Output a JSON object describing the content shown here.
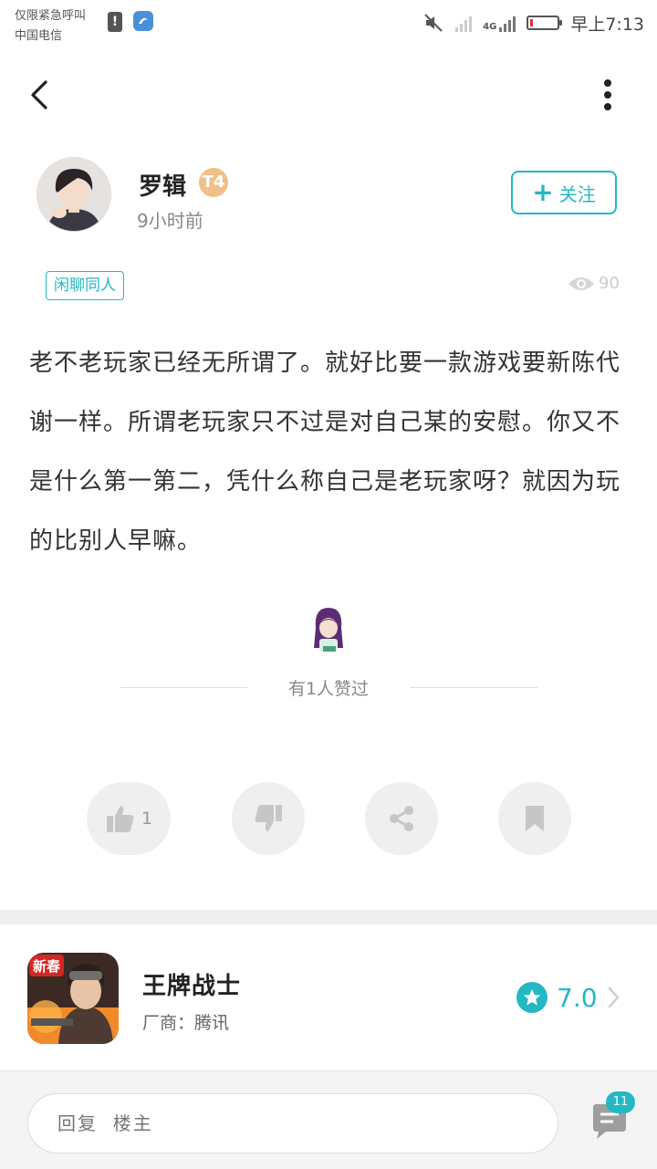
{
  "status_bar": {
    "carrier_line1": "仅限紧急呼叫",
    "carrier_line2": "中国电信",
    "network": "4G",
    "time": "早上7:13",
    "icons": [
      "alert-icon",
      "app-notification-icon",
      "mute-icon",
      "no-signal-icon",
      "signal-icon",
      "battery-icon"
    ],
    "battery_level": 0.1
  },
  "header": {
    "back_icon": "chevron-left-icon",
    "more_icon": "more-vertical-icon"
  },
  "author": {
    "name": "罗辑",
    "level": "T4",
    "time": "9小时前",
    "follow_label": "关注"
  },
  "post": {
    "tag": "闲聊同人",
    "views": "90",
    "content": "老不老玩家已经无所谓了。就好比要一款游戏要新陈代谢一样。所谓老玩家只不过是对自己某的安慰。你又不是什么第一第二，凭什么称自己是老玩家呀？就因为玩的比别人早嘛。",
    "likes_summary": "有1人赞过"
  },
  "actions": {
    "like_count": "1",
    "icons": [
      "thumbs-up-icon",
      "thumbs-down-icon",
      "share-icon",
      "bookmark-icon"
    ]
  },
  "game": {
    "name": "王牌战士",
    "vendor": "厂商：腾讯",
    "rating": "7.0",
    "icon_banner": "新春"
  },
  "reply": {
    "placeholder": "回复  楼主",
    "comment_count": "11"
  },
  "colors": {
    "accent": "#23b8c4",
    "battery_low": "#e03131"
  }
}
